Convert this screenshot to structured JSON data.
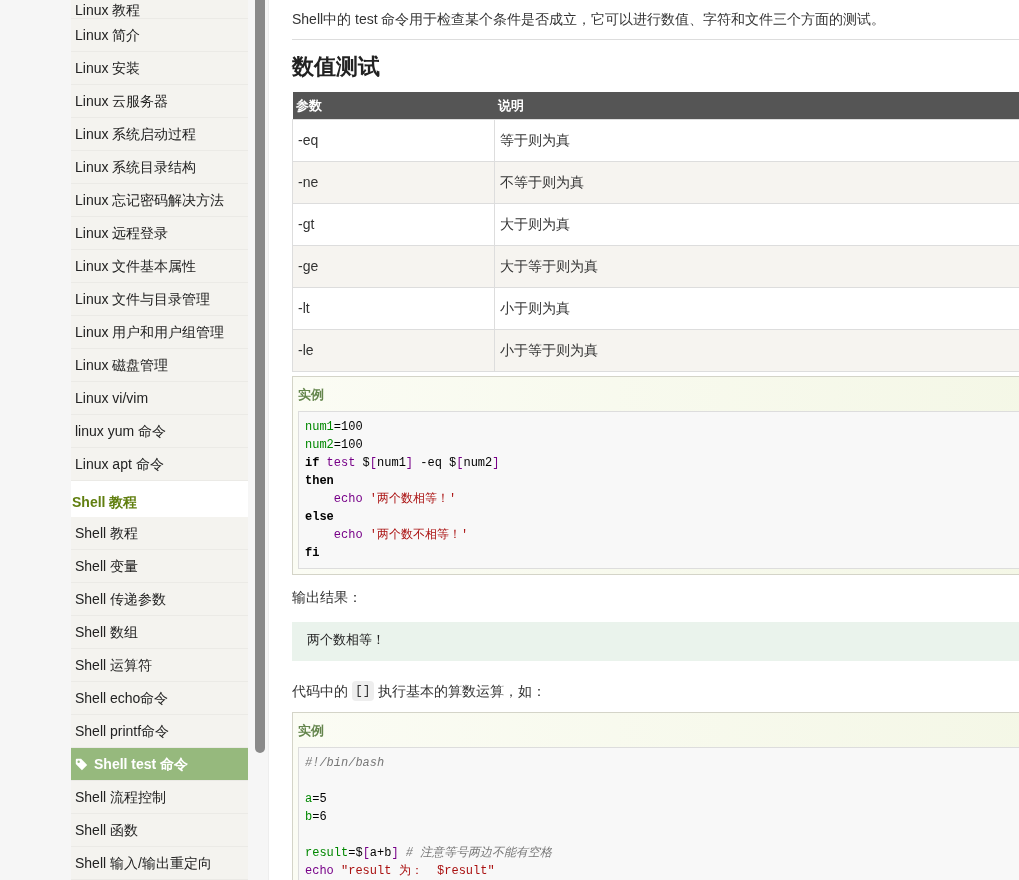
{
  "sidebar": {
    "linux_items": [
      {
        "label": "Linux 教程",
        "selected": false
      },
      {
        "label": "Linux 简介",
        "selected": false
      },
      {
        "label": "Linux 安装",
        "selected": false
      },
      {
        "label": "Linux 云服务器",
        "selected": false
      },
      {
        "label": "Linux 系统启动过程",
        "selected": false
      },
      {
        "label": "Linux 系统目录结构",
        "selected": false
      },
      {
        "label": "Linux 忘记密码解决方法",
        "selected": false
      },
      {
        "label": "Linux 远程登录",
        "selected": false
      },
      {
        "label": "Linux 文件基本属性",
        "selected": false
      },
      {
        "label": "Linux 文件与目录管理",
        "selected": false
      },
      {
        "label": "Linux 用户和用户组管理",
        "selected": false
      },
      {
        "label": "Linux 磁盘管理",
        "selected": false
      },
      {
        "label": "Linux vi/vim",
        "selected": false
      },
      {
        "label": "linux yum 命令",
        "selected": false
      },
      {
        "label": "Linux apt 命令",
        "selected": false
      }
    ],
    "shell_section": {
      "heading": "Shell 教程",
      "items": [
        {
          "label": "Shell 教程",
          "selected": false
        },
        {
          "label": "Shell 变量",
          "selected": false
        },
        {
          "label": "Shell 传递参数",
          "selected": false
        },
        {
          "label": "Shell 数组",
          "selected": false
        },
        {
          "label": "Shell 运算符",
          "selected": false
        },
        {
          "label": "Shell echo命令",
          "selected": false
        },
        {
          "label": "Shell printf命令",
          "selected": false
        },
        {
          "label": "Shell test 命令",
          "selected": true
        },
        {
          "label": "Shell 流程控制",
          "selected": false
        },
        {
          "label": "Shell 函数",
          "selected": false
        },
        {
          "label": "Shell 输入/输出重定向",
          "selected": false
        }
      ]
    }
  },
  "content": {
    "intro": "Shell中的 test 命令用于检查某个条件是否成立，它可以进行数值、字符和文件三个方面的测试。",
    "section_title": "数值测试",
    "table": {
      "columns": [
        "参数",
        "说明"
      ],
      "rows": [
        [
          "-eq",
          "等于则为真"
        ],
        [
          "-ne",
          "不等于则为真"
        ],
        [
          "-gt",
          "大于则为真"
        ],
        [
          "-ge",
          "大于等于则为真"
        ],
        [
          "-lt",
          "小于则为真"
        ],
        [
          "-le",
          "小于等于则为真"
        ]
      ]
    },
    "example_1": {
      "title": "实例",
      "lines": [
        {
          "tokens": [
            {
              "kind": "var",
              "text": "num1"
            },
            {
              "kind": "plain",
              "text": "=100"
            }
          ]
        },
        {
          "tokens": [
            {
              "kind": "var",
              "text": "num2"
            },
            {
              "kind": "plain",
              "text": "=100"
            }
          ]
        },
        {
          "tokens": [
            {
              "kind": "keyword",
              "text": "if "
            },
            {
              "kind": "builtin",
              "text": "test"
            },
            {
              "kind": "plain",
              "text": " $"
            },
            {
              "kind": "builtin",
              "text": "["
            },
            {
              "kind": "plain",
              "text": "num1"
            },
            {
              "kind": "builtin",
              "text": "]"
            },
            {
              "kind": "plain",
              "text": " -eq $"
            },
            {
              "kind": "builtin",
              "text": "["
            },
            {
              "kind": "plain",
              "text": "num2"
            },
            {
              "kind": "builtin",
              "text": "]"
            }
          ]
        },
        {
          "tokens": [
            {
              "kind": "keyword",
              "text": "then"
            }
          ]
        },
        {
          "tokens": [
            {
              "kind": "builtin",
              "text": "    echo "
            },
            {
              "kind": "string",
              "text": "'两个数相等！'"
            }
          ]
        },
        {
          "tokens": [
            {
              "kind": "keyword",
              "text": "else"
            }
          ]
        },
        {
          "tokens": [
            {
              "kind": "builtin",
              "text": "    echo "
            },
            {
              "kind": "string",
              "text": "'两个数不相等！'"
            }
          ]
        },
        {
          "tokens": [
            {
              "kind": "keyword",
              "text": "fi"
            }
          ]
        }
      ]
    },
    "output_label": "输出结果：",
    "output": "两个数相等！",
    "paragraph": {
      "before": "代码中的",
      "code": "[]",
      "after": "执行基本的算数运算，如："
    },
    "example_2": {
      "title": "实例",
      "lines": [
        {
          "tokens": [
            {
              "kind": "comment",
              "text": "#!/bin/bash"
            }
          ]
        },
        {
          "blank_before": true,
          "tokens": [
            {
              "kind": "var",
              "text": "a"
            },
            {
              "kind": "plain",
              "text": "=5"
            }
          ]
        },
        {
          "tokens": [
            {
              "kind": "var",
              "text": "b"
            },
            {
              "kind": "plain",
              "text": "=6"
            }
          ]
        },
        {
          "blank_before": true,
          "tokens": [
            {
              "kind": "var",
              "text": "result"
            },
            {
              "kind": "plain",
              "text": "=$"
            },
            {
              "kind": "builtin",
              "text": "["
            },
            {
              "kind": "plain",
              "text": "a+b"
            },
            {
              "kind": "builtin",
              "text": "] "
            },
            {
              "kind": "comment",
              "text": "# 注意等号两边不能有空格"
            }
          ]
        },
        {
          "tokens": [
            {
              "kind": "builtin",
              "text": "echo "
            },
            {
              "kind": "string",
              "text": "\"result 为：  $result\""
            }
          ]
        }
      ]
    }
  }
}
